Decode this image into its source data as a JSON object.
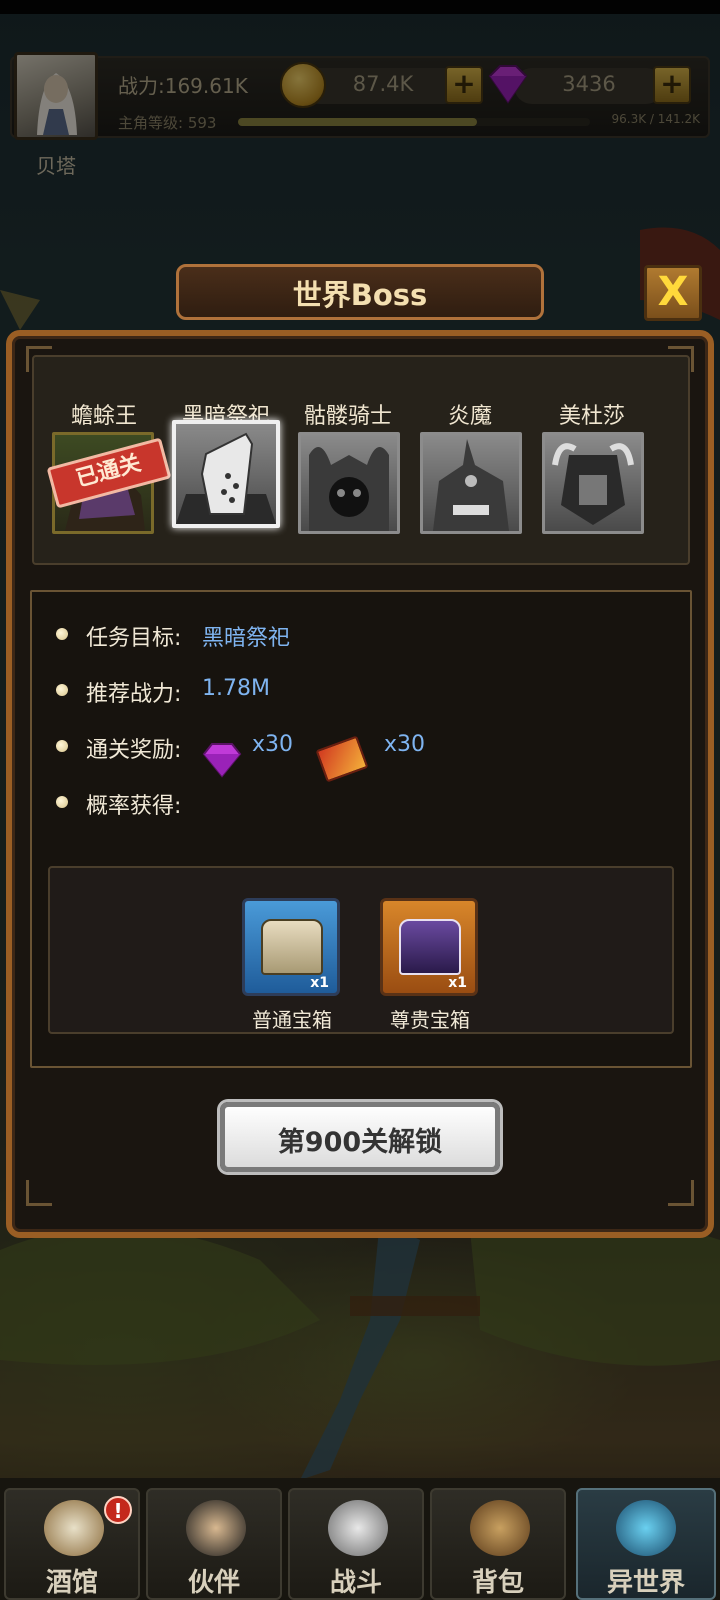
{
  "header": {
    "avatar_name": "贝塔",
    "power": "战力:169.61K",
    "level_label": "主角等级: 593",
    "level_fraction": 0.68,
    "exp_text": "96.3K / 141.2K",
    "gold": "87.4K",
    "gems": "3436",
    "gold_plus": "+",
    "gem_plus": "+"
  },
  "dialog": {
    "title": "世界Boss",
    "close_label": "X"
  },
  "bosses": [
    {
      "name": "蟾蜍王",
      "status": "已通关"
    },
    {
      "name": "黑暗祭祀"
    },
    {
      "name": "骷髅骑士"
    },
    {
      "name": "炎魔"
    },
    {
      "name": "美杜莎"
    }
  ],
  "info": {
    "target_label": "任务目标:",
    "target_value": "黑暗祭祀",
    "power_label": "推荐战力:",
    "power_value": "1.78M",
    "reward_label": "通关奖励:",
    "reward_gem_count": "x30",
    "reward_ticket_count": "x30",
    "chance_label": "概率获得:"
  },
  "chests": [
    {
      "name": "普通宝箱",
      "count": "x1"
    },
    {
      "name": "尊贵宝箱",
      "count": "x1"
    }
  ],
  "unlock_button": "第900关解锁",
  "nav": [
    {
      "label": "酒馆",
      "badge": "!"
    },
    {
      "label": "伙伴"
    },
    {
      "label": "战斗"
    },
    {
      "label": "背包"
    },
    {
      "label": "异世界"
    }
  ],
  "colors": {
    "accent_blue": "#7fb4f0",
    "panel_border": "#9a5e24",
    "gem": "#c03ad8",
    "gold": "#d8a93a"
  }
}
